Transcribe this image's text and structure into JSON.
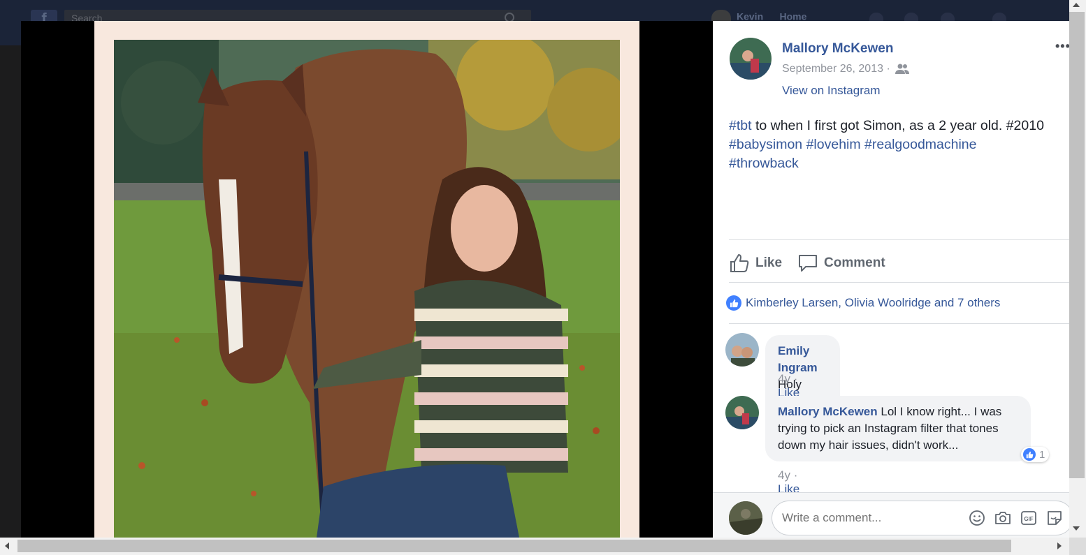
{
  "background_header": {
    "search_placeholder": "Search",
    "user_name": "Kevin",
    "home_label": "Home"
  },
  "post": {
    "author": "Mallory McKewen",
    "date": "September 26, 2013 ·",
    "view_link": "View on Instagram",
    "more_label": "•••",
    "caption": {
      "tag_tbt": "#tbt",
      "text": " to when I first got Simon, as a 2 year old. #2010",
      "tag_babysimon": "#babysimon",
      "tag_lovehim": "#lovehim",
      "tag_realgoodmachine": "#realgoodmachine",
      "tag_throwback": "#throwback"
    },
    "audience_icon": "friends-icon"
  },
  "actions": {
    "like_label": "Like",
    "comment_label": "Comment"
  },
  "reactions": {
    "summary": "Kimberley Larsen, Olivia Woolridge and 7 others"
  },
  "comments": [
    {
      "author": "Emily Ingram",
      "text": "Holy static electricity lol",
      "time": "4y",
      "like_label": "Like"
    },
    {
      "author": "Mallory McKewen",
      "text": "Lol I know right... I was trying to pick an Instagram filter that tones down my hair issues, didn't work...",
      "line1": "Lol I know right... I was",
      "line2": "trying to pick an Instagram filter that tones",
      "line3": "down my hair issues, didn't work...",
      "time": "4y",
      "like_label": "Like",
      "reaction_count": "1"
    }
  ],
  "composer": {
    "placeholder": "Write a comment...",
    "icons": [
      "emoji-icon",
      "camera-icon",
      "gif-icon",
      "sticker-icon"
    ]
  },
  "colors": {
    "link": "#365899",
    "like_blue": "#4080ff",
    "stage": "#000000"
  }
}
